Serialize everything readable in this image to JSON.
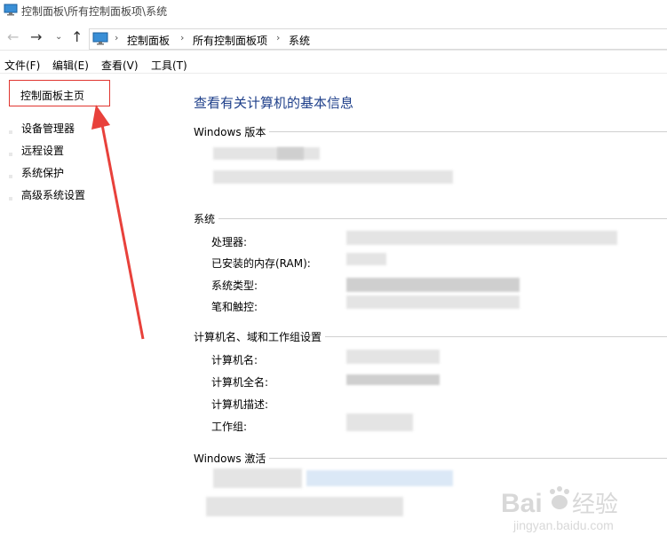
{
  "window": {
    "title": "控制面板\\所有控制面板项\\系统"
  },
  "nav": {
    "breadcrumbs": [
      "控制面板",
      "所有控制面板项",
      "系统"
    ]
  },
  "menu": [
    "文件(F)",
    "编辑(E)",
    "查看(V)",
    "工具(T)"
  ],
  "sidebar": {
    "home": "控制面板主页",
    "links": [
      "设备管理器",
      "远程设置",
      "系统保护",
      "高级系统设置"
    ]
  },
  "main": {
    "title": "查看有关计算机的基本信息",
    "edition_header": "Windows 版本",
    "system_header": "系统",
    "system_labels": [
      "处理器:",
      "已安装的内存(RAM):",
      "系统类型:",
      "笔和触控:"
    ],
    "computer_header": "计算机名、域和工作组设置",
    "computer_labels": [
      "计算机名:",
      "计算机全名:",
      "计算机描述:",
      "工作组:"
    ],
    "activation_header": "Windows 激活"
  },
  "annotation": {
    "color": "#e8413b"
  },
  "watermark": {
    "brand": "Bai",
    "brand2": "经验",
    "url": "jingyan.baidu.com"
  }
}
